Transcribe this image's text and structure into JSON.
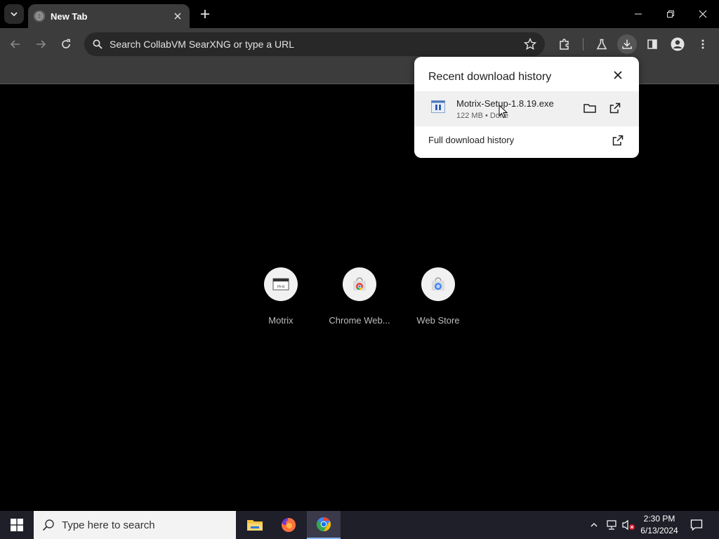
{
  "browser": {
    "tab": {
      "title": "New Tab"
    },
    "omnibox": {
      "placeholder": "Search CollabVM SearXNG or type a URL"
    }
  },
  "download_bubble": {
    "title": "Recent download history",
    "item": {
      "filename": "Motrix-Setup-1.8.19.exe",
      "status": "122 MB • Done"
    },
    "full_history_label": "Full download history"
  },
  "shortcuts": [
    {
      "label": "Motrix"
    },
    {
      "label": "Chrome Web..."
    },
    {
      "label": "Web Store"
    }
  ],
  "taskbar": {
    "search_placeholder": "Type here to search",
    "time": "2:30 PM",
    "date": "6/13/2024"
  },
  "colors": {
    "toolbar_bg": "#3c3c3c",
    "page_bg": "#000000",
    "bubble_bg": "#ffffff",
    "taskbar_bg": "#1f1f2a"
  }
}
